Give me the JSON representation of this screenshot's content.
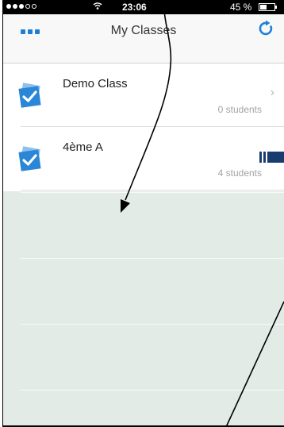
{
  "status_bar": {
    "time": "23:06",
    "battery_percent": "45 %",
    "battery_level": 0.45,
    "signal_bars_filled": 3,
    "signal_bars_total": 5,
    "wifi_icon": "wifi-icon"
  },
  "navbar": {
    "title": "My Classes",
    "menu_icon": "more-dots-icon",
    "refresh_icon": "refresh-icon",
    "accent_color": "#1f7fd8"
  },
  "classes": [
    {
      "name": "Demo Class",
      "students": "0 students",
      "trailing": "chevron-right-icon"
    },
    {
      "name": "4ème A",
      "students": "4 students",
      "trailing": "bar-indicator-icon"
    }
  ],
  "colors": {
    "class_icon": "#2a86d6",
    "empty_background": "#e3ebe6",
    "indicator": "#183c6f"
  }
}
